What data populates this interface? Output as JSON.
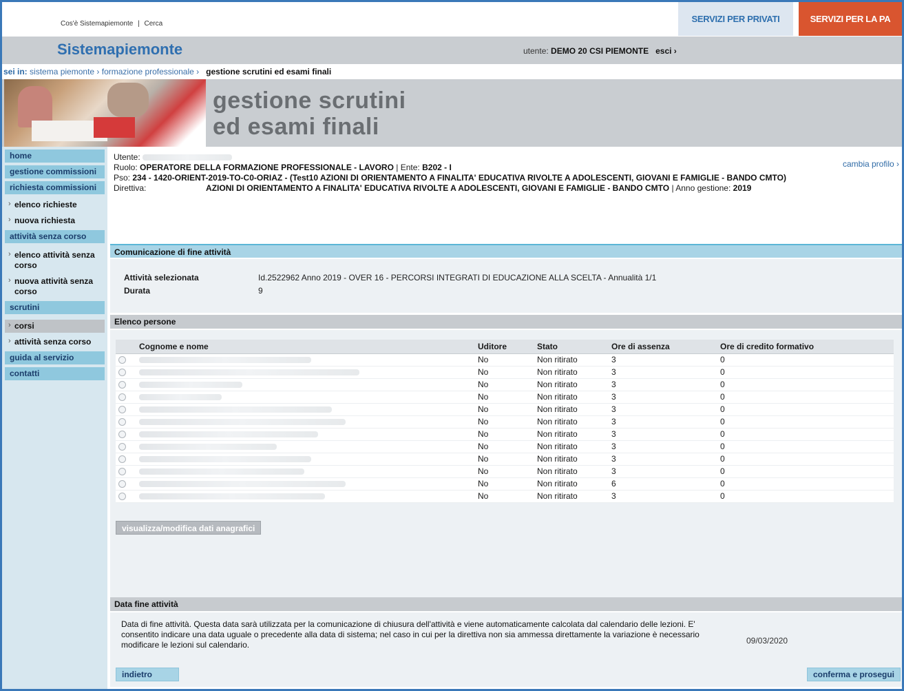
{
  "top": {
    "links": [
      "Cos'è Sistemapiemonte",
      "|",
      "Cerca"
    ],
    "svc_private": "SERVIZI PER PRIVATI",
    "svc_pa": "SERVIZI PER LA PA"
  },
  "brand": {
    "name": "Sistemapiemonte",
    "user_label": "utente:",
    "user_name": "DEMO 20 CSI PIEMONTE",
    "logout": "esci ›"
  },
  "breadcrumb": {
    "label": "sei in:",
    "items": [
      "sistema piemonte ›",
      "formazione professionale ›"
    ],
    "current": "gestione scrutini ed esami finali"
  },
  "hero": {
    "line1": "gestione scrutini",
    "line2": "ed esami finali"
  },
  "sidebar": {
    "items": [
      {
        "label": "home",
        "type": "main"
      },
      {
        "label": "gestione commissioni",
        "type": "main"
      },
      {
        "label": "richiesta commissioni",
        "type": "main"
      },
      {
        "label": "elenco richieste",
        "type": "sub"
      },
      {
        "label": "nuova richiesta",
        "type": "sub"
      },
      {
        "label": "attività senza corso",
        "type": "main"
      },
      {
        "label": "elenco attività senza corso",
        "type": "sub"
      },
      {
        "label": "nuova attività senza corso",
        "type": "sub"
      },
      {
        "label": "scrutini",
        "type": "main"
      },
      {
        "label": "corsi",
        "type": "sub-active"
      },
      {
        "label": "attività senza corso",
        "type": "sub"
      },
      {
        "label": "guida al servizio",
        "type": "main"
      },
      {
        "label": "contatti",
        "type": "main"
      }
    ]
  },
  "profile": {
    "utente_label": "Utente:",
    "ruolo_label": "Ruolo:",
    "ruolo_value": "OPERATORE DELLA FORMAZIONE PROFESSIONALE - LAVORO",
    "ente_label": "| Ente:",
    "ente_value": "B202 - I",
    "pso_label": "Pso:",
    "pso_value": "234 - 1420-ORIENT-2019-TO-C0-ORIAZ - (Test10 AZIONI DI ORIENTAMENTO A FINALITA' EDUCATIVA RIVOLTE A ADOLESCENTI, GIOVANI E FAMIGLIE - BANDO CMTO)",
    "direttiva_label": "Direttiva:",
    "direttiva_value": "AZIONI DI ORIENTAMENTO A FINALITA' EDUCATIVA RIVOLTE A ADOLESCENTI, GIOVANI E FAMIGLIE - BANDO CMTO",
    "anno_label": "| Anno gestione:",
    "anno_value": "2019",
    "cambia": "cambia profilo ›"
  },
  "fine_attivita": {
    "title": "Comunicazione di fine attività",
    "selected_label": "Attività selezionata",
    "selected_value": "Id.2522962 Anno 2019 - OVER 16 - PERCORSI INTEGRATI DI EDUCAZIONE ALLA SCELTA - Annualità 1/1",
    "durata_label": "Durata",
    "durata_value": "9"
  },
  "persone": {
    "title": "Elenco persone",
    "columns": [
      "Cognome e nome",
      "Uditore",
      "Stato",
      "Ore di assenza",
      "Ore di credito formativo"
    ],
    "rows": [
      {
        "uditore": "No",
        "stato": "Non ritirato",
        "assenza": "3",
        "credito": "0"
      },
      {
        "uditore": "No",
        "stato": "Non ritirato",
        "assenza": "3",
        "credito": "0"
      },
      {
        "uditore": "No",
        "stato": "Non ritirato",
        "assenza": "3",
        "credito": "0"
      },
      {
        "uditore": "No",
        "stato": "Non ritirato",
        "assenza": "3",
        "credito": "0"
      },
      {
        "uditore": "No",
        "stato": "Non ritirato",
        "assenza": "3",
        "credito": "0"
      },
      {
        "uditore": "No",
        "stato": "Non ritirato",
        "assenza": "3",
        "credito": "0"
      },
      {
        "uditore": "No",
        "stato": "Non ritirato",
        "assenza": "3",
        "credito": "0"
      },
      {
        "uditore": "No",
        "stato": "Non ritirato",
        "assenza": "3",
        "credito": "0"
      },
      {
        "uditore": "No",
        "stato": "Non ritirato",
        "assenza": "3",
        "credito": "0"
      },
      {
        "uditore": "No",
        "stato": "Non ritirato",
        "assenza": "3",
        "credito": "0"
      },
      {
        "uditore": "No",
        "stato": "Non ritirato",
        "assenza": "6",
        "credito": "0"
      },
      {
        "uditore": "No",
        "stato": "Non ritirato",
        "assenza": "3",
        "credito": "0"
      }
    ],
    "button": "visualizza/modifica dati anagrafici"
  },
  "data_fine": {
    "title": "Data fine attività",
    "text": "Data di fine attività. Questa data sarà utilizzata per la comunicazione di chiusura dell'attività e viene automaticamente calcolata dal calendario delle lezioni. E' consentito indicare una data uguale o precedente alla data di sistema; nel caso in cui per la direttiva non sia ammessa direttamente la variazione è necessario modificare le lezioni sul calendario.",
    "date": "09/03/2020",
    "back": "indietro",
    "confirm": "conferma e prosegui"
  }
}
